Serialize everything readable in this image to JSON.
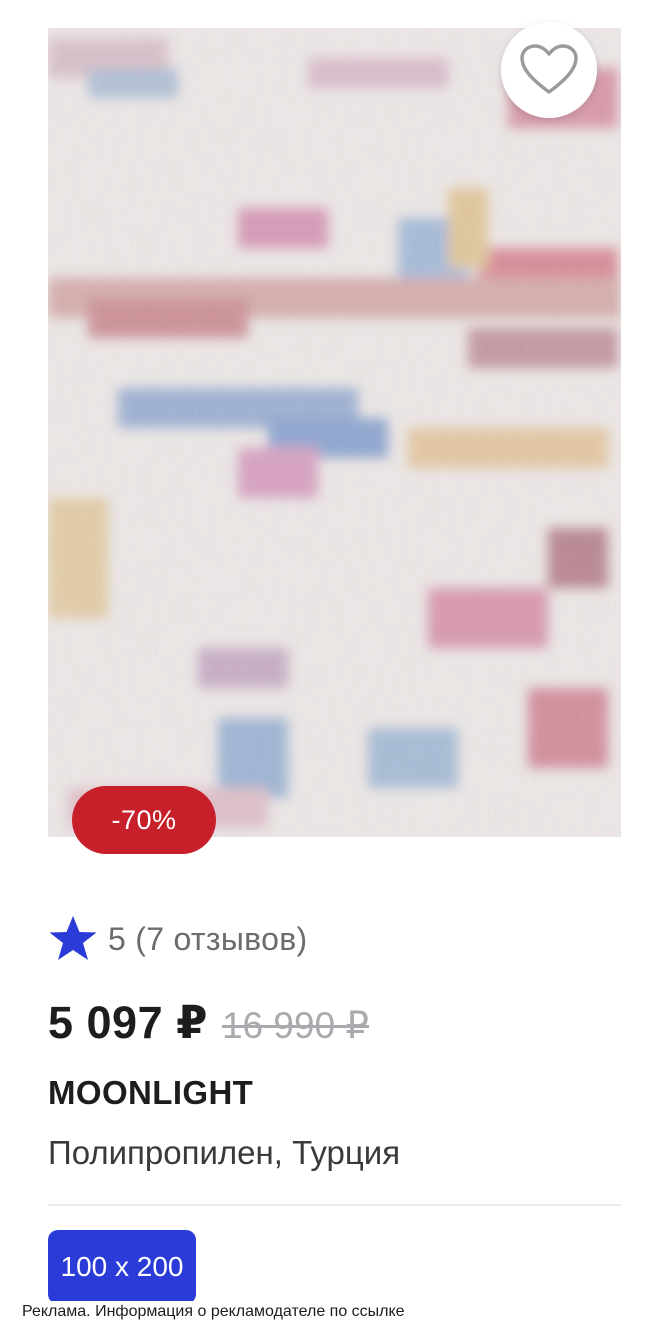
{
  "product": {
    "image_alt": "carpet-image",
    "favorite_icon": "heart-outline-icon",
    "discount": "-70%",
    "rating_icon": "star-icon",
    "rating_text": "5 (7 отзывов)",
    "price_current": "5 097 ₽",
    "price_old": "16 990 ₽",
    "brand": "MOONLIGHT",
    "subtitle": "Полипропилен, Турция",
    "size_option": "100 x 200"
  },
  "ad": {
    "disclaimer": "Реклама. Информация о рекламодателе по ссылке"
  },
  "colors": {
    "accent_blue": "#2a3bd8",
    "discount_red": "#c8202b",
    "star_blue": "#2a3bd8"
  }
}
